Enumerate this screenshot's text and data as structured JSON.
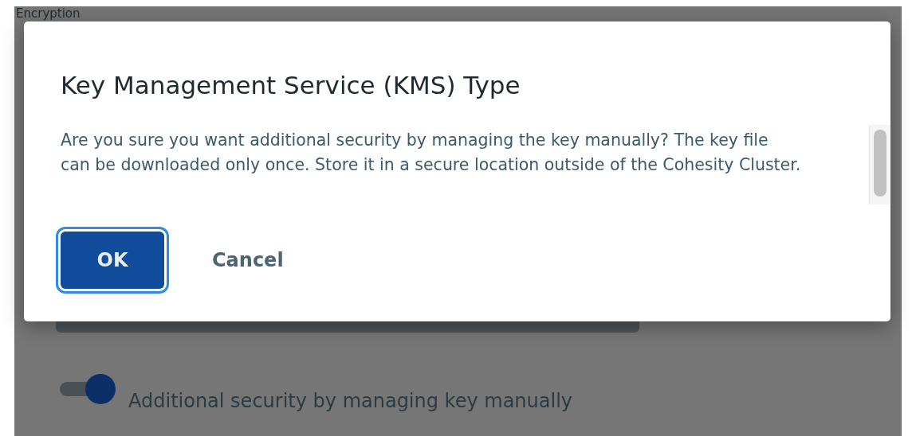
{
  "background": {
    "heading": "Encryption",
    "toggle": {
      "label": "Additional security by managing key manually",
      "on": true
    }
  },
  "dialog": {
    "title": "Key Management Service (KMS) Type",
    "message": "Are you sure you want additional security by managing the key manually? The key file can be downloaded only once. Store it in a secure location outside of the Cohesity Cluster.",
    "buttons": [
      {
        "label": "OK",
        "kind": "primary",
        "focused": true
      },
      {
        "label": "Cancel",
        "kind": "text",
        "focused": false
      }
    ]
  }
}
